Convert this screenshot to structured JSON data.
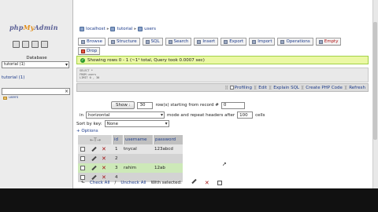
{
  "nav": {
    "logo_prefix": "php",
    "logo_my": "My",
    "logo_suffix": "Admin",
    "database_label": "Database",
    "database_selected": "tutorial (1)",
    "db_title": "tutorial (1)",
    "filter_clear": "×",
    "table_item": "users"
  },
  "breadcrumb": {
    "server": "localhost",
    "database": "tutorial",
    "table": "users"
  },
  "tabs": [
    {
      "label": "Browse",
      "icon": "browse-icon"
    },
    {
      "label": "Structure",
      "icon": "structure-icon"
    },
    {
      "label": "SQL",
      "icon": "sql-icon"
    },
    {
      "label": "Search",
      "icon": "search-icon"
    },
    {
      "label": "Insert",
      "icon": "insert-icon"
    },
    {
      "label": "Export",
      "icon": "export-icon"
    },
    {
      "label": "Import",
      "icon": "import-icon"
    },
    {
      "label": "Operations",
      "icon": "operations-icon"
    },
    {
      "label": "Empty",
      "icon": "empty-icon"
    },
    {
      "label": "Drop",
      "icon": "drop-icon"
    }
  ],
  "message": {
    "text": "Showing rows 0 - 1 (~1¹ total, Query took 0.0007 sec)"
  },
  "sql": {
    "line1": "SELECT *",
    "line2": "FROM users",
    "line3": "LIMIT 0 , 30"
  },
  "sql_links": {
    "profiling": "Profiling",
    "edit": "Edit",
    "explain": "Explain SQL",
    "create_php": "Create PHP Code",
    "refresh": "Refresh",
    "separator": "]["
  },
  "show_bar": {
    "show_button": "Show :",
    "rows_value": "30",
    "rows_text": "row(s) starting from record #",
    "start_value": "0"
  },
  "mode_bar": {
    "in_label": "in",
    "mode_selected": "horizontal",
    "mode_text": "mode and repeat headers after",
    "repeat_value": "100",
    "cells_label": "cells"
  },
  "sort_bar": {
    "label": "Sort by key:",
    "selected": "None"
  },
  "options_label": "+ Options",
  "results": {
    "sort_arrows": "←T→",
    "columns": [
      "id",
      "username",
      "password"
    ],
    "rows": [
      {
        "id": "1",
        "username": "tnycal",
        "password": "123abcd"
      },
      {
        "id": "2",
        "username": "",
        "password": ""
      },
      {
        "id": "3",
        "username": "rahim",
        "password": "12ab"
      },
      {
        "id": "4",
        "username": "",
        "password": ""
      }
    ]
  },
  "footer": {
    "check_all": "Check All",
    "divider": "/",
    "uncheck_all": "Uncheck All",
    "with_selected": "With selected:"
  },
  "colors": {
    "link": "#1b3a8a",
    "success_bg": "#ebf8a4",
    "row_highlight": "#cde9b8",
    "empty_tab": "#b01010"
  }
}
